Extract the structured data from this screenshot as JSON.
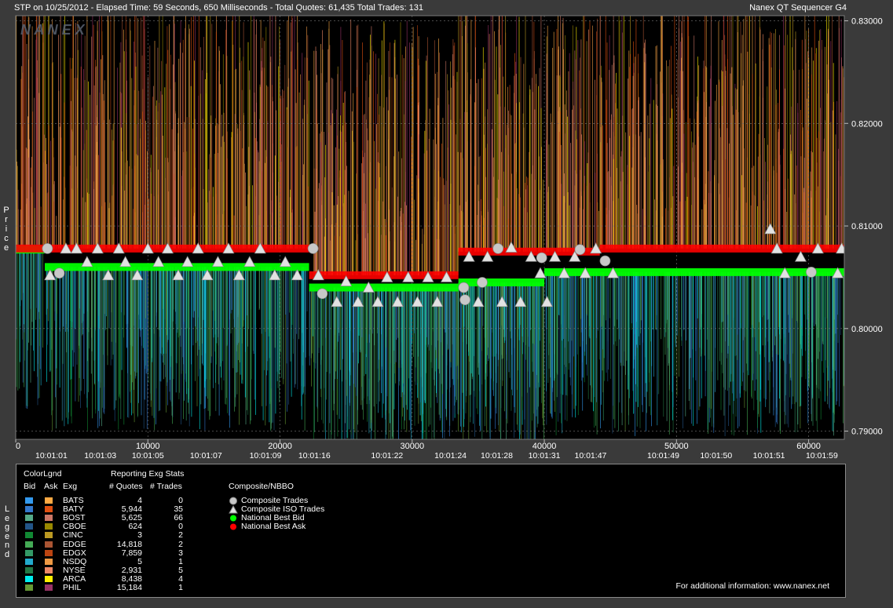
{
  "header": {
    "left": "STP on 10/25/2012  -  Elapsed Time: 59 Seconds, 650 Milliseconds  -  Total Quotes: 61,435  Total Trades: 131",
    "right": "Nanex QT Sequencer G4"
  },
  "watermark": "N A N E X",
  "y_axis_label": [
    "P",
    "r",
    "i",
    "c",
    "e"
  ],
  "legend_vertical": [
    "L",
    "e",
    "g",
    "e",
    "n",
    "d"
  ],
  "colors": {
    "background": "#000000",
    "frame": "#3a3a3a",
    "national_best_bid": "#00ff00",
    "national_best_ask": "#ff0000",
    "trade_marker": "#c8c8c8"
  },
  "chart_data": {
    "type": "scatter",
    "title": "",
    "xlabel": "",
    "ylabel": "Price",
    "xlim": [
      0,
      62700
    ],
    "ylim": [
      0.7892,
      0.8305
    ],
    "y_ticks": [
      "0.83000",
      "0.82000",
      "0.81000",
      "0.80000",
      "0.79000"
    ],
    "x_ticks": [
      {
        "v": 0,
        "label": "0"
      },
      {
        "v": 10000,
        "label": "10000"
      },
      {
        "v": 20000,
        "label": "20000"
      },
      {
        "v": 30000,
        "label": "30000"
      },
      {
        "v": 40000,
        "label": "40000"
      },
      {
        "v": 50000,
        "label": "50000"
      },
      {
        "v": 60000,
        "label": "60000"
      }
    ],
    "time_labels": [
      {
        "v": 2700,
        "label": "10:01:01"
      },
      {
        "v": 6400,
        "label": "10:01:03"
      },
      {
        "v": 10000,
        "label": "10:01:05"
      },
      {
        "v": 14400,
        "label": "10:01:07"
      },
      {
        "v": 18900,
        "label": "10:01:09"
      },
      {
        "v": 22600,
        "label": "10:01:16"
      },
      {
        "v": 28100,
        "label": "10:01:22"
      },
      {
        "v": 32900,
        "label": "10:01:24"
      },
      {
        "v": 36400,
        "label": "10:01:28"
      },
      {
        "v": 40000,
        "label": "10:01:31"
      },
      {
        "v": 43500,
        "label": "10:01:47"
      },
      {
        "v": 49000,
        "label": "10:01:49"
      },
      {
        "v": 53000,
        "label": "10:01:50"
      },
      {
        "v": 57000,
        "label": "10:01:51"
      },
      {
        "v": 61000,
        "label": "10:01:59"
      }
    ],
    "best_bid": [
      {
        "x0": 0,
        "x1": 2200,
        "y": 0.8077
      },
      {
        "x0": 2200,
        "x1": 22200,
        "y": 0.806
      },
      {
        "x0": 22200,
        "x1": 33500,
        "y": 0.804
      },
      {
        "x0": 33500,
        "x1": 40000,
        "y": 0.8045
      },
      {
        "x0": 40000,
        "x1": 62700,
        "y": 0.8055
      }
    ],
    "best_ask": [
      {
        "x0": 0,
        "x1": 22200,
        "y": 0.8078
      },
      {
        "x0": 22200,
        "x1": 33500,
        "y": 0.8052
      },
      {
        "x0": 33500,
        "x1": 44200,
        "y": 0.8075
      },
      {
        "x0": 44200,
        "x1": 62700,
        "y": 0.8078
      }
    ],
    "composite_trades": [
      {
        "x": 2400,
        "y": 0.8078
      },
      {
        "x": 3300,
        "y": 0.8054
      },
      {
        "x": 22500,
        "y": 0.8078
      },
      {
        "x": 23200,
        "y": 0.8034
      },
      {
        "x": 33900,
        "y": 0.804
      },
      {
        "x": 34000,
        "y": 0.8028
      },
      {
        "x": 35300,
        "y": 0.8045
      },
      {
        "x": 36500,
        "y": 0.8078
      },
      {
        "x": 39800,
        "y": 0.8069
      },
      {
        "x": 42700,
        "y": 0.8077
      },
      {
        "x": 44600,
        "y": 0.8066
      },
      {
        "x": 60200,
        "y": 0.8055
      }
    ],
    "iso_trades": [
      {
        "x": 2600,
        "y": 0.8052
      },
      {
        "x": 3800,
        "y": 0.8078
      },
      {
        "x": 4600,
        "y": 0.8078
      },
      {
        "x": 5400,
        "y": 0.8065
      },
      {
        "x": 6200,
        "y": 0.8078
      },
      {
        "x": 7000,
        "y": 0.8052
      },
      {
        "x": 7800,
        "y": 0.8078
      },
      {
        "x": 8300,
        "y": 0.8065
      },
      {
        "x": 9200,
        "y": 0.8052
      },
      {
        "x": 10000,
        "y": 0.8078
      },
      {
        "x": 10800,
        "y": 0.8065
      },
      {
        "x": 11500,
        "y": 0.8078
      },
      {
        "x": 12300,
        "y": 0.8052
      },
      {
        "x": 13000,
        "y": 0.8065
      },
      {
        "x": 13800,
        "y": 0.8078
      },
      {
        "x": 14500,
        "y": 0.8052
      },
      {
        "x": 15300,
        "y": 0.8065
      },
      {
        "x": 16100,
        "y": 0.8078
      },
      {
        "x": 16900,
        "y": 0.8052
      },
      {
        "x": 17700,
        "y": 0.8065
      },
      {
        "x": 18500,
        "y": 0.8078
      },
      {
        "x": 19600,
        "y": 0.8052
      },
      {
        "x": 20400,
        "y": 0.8065
      },
      {
        "x": 21300,
        "y": 0.8052
      },
      {
        "x": 22900,
        "y": 0.8052
      },
      {
        "x": 24300,
        "y": 0.8026
      },
      {
        "x": 25000,
        "y": 0.8046
      },
      {
        "x": 25900,
        "y": 0.8026
      },
      {
        "x": 26700,
        "y": 0.804
      },
      {
        "x": 27400,
        "y": 0.8026
      },
      {
        "x": 28100,
        "y": 0.805
      },
      {
        "x": 28900,
        "y": 0.8026
      },
      {
        "x": 29700,
        "y": 0.805
      },
      {
        "x": 30400,
        "y": 0.8026
      },
      {
        "x": 31200,
        "y": 0.805
      },
      {
        "x": 31900,
        "y": 0.8026
      },
      {
        "x": 32600,
        "y": 0.805
      },
      {
        "x": 34300,
        "y": 0.807
      },
      {
        "x": 35000,
        "y": 0.8026
      },
      {
        "x": 35700,
        "y": 0.807
      },
      {
        "x": 36800,
        "y": 0.8026
      },
      {
        "x": 37500,
        "y": 0.8079
      },
      {
        "x": 38200,
        "y": 0.8026
      },
      {
        "x": 39000,
        "y": 0.807
      },
      {
        "x": 39700,
        "y": 0.8054
      },
      {
        "x": 40200,
        "y": 0.8026
      },
      {
        "x": 40800,
        "y": 0.807
      },
      {
        "x": 41500,
        "y": 0.8054
      },
      {
        "x": 42300,
        "y": 0.807
      },
      {
        "x": 43100,
        "y": 0.8054
      },
      {
        "x": 43900,
        "y": 0.8078
      },
      {
        "x": 45200,
        "y": 0.8054
      },
      {
        "x": 57100,
        "y": 0.8097
      },
      {
        "x": 57600,
        "y": 0.8078
      },
      {
        "x": 58200,
        "y": 0.8054
      },
      {
        "x": 59400,
        "y": 0.807
      },
      {
        "x": 60700,
        "y": 0.8078
      },
      {
        "x": 62200,
        "y": 0.8054
      },
      {
        "x": 62500,
        "y": 0.8078
      }
    ]
  },
  "legend": {
    "color_legend_title": "ColorLgnd",
    "bid_header": "Bid",
    "ask_header": "Ask",
    "exg_header": "Exg",
    "stats_title": "Reporting Exg Stats",
    "quotes_header": "# Quotes",
    "trades_header": "# Trades",
    "composite_title": "Composite/NBBO",
    "rows": [
      {
        "exg": "BATS",
        "quotes": "4",
        "trades": "0",
        "bid_color": "#3399ee",
        "ask_color": "#ffaa44"
      },
      {
        "exg": "BATY",
        "quotes": "5,944",
        "trades": "35",
        "bid_color": "#3377cc",
        "ask_color": "#e05010"
      },
      {
        "exg": "BOST",
        "quotes": "5,625",
        "trades": "66",
        "bid_color": "#55aa88",
        "ask_color": "#cc7766"
      },
      {
        "exg": "CBOE",
        "quotes": "624",
        "trades": "0",
        "bid_color": "#225588",
        "ask_color": "#998800"
      },
      {
        "exg": "CINC",
        "quotes": "3",
        "trades": "2",
        "bid_color": "#118833",
        "ask_color": "#bb9922"
      },
      {
        "exg": "EDGE",
        "quotes": "14,818",
        "trades": "2",
        "bid_color": "#44aa55",
        "ask_color": "#aa5533"
      },
      {
        "exg": "EDGX",
        "quotes": "7,859",
        "trades": "3",
        "bid_color": "#339966",
        "ask_color": "#bb4411"
      },
      {
        "exg": "NSDQ",
        "quotes": "5",
        "trades": "1",
        "bid_color": "#22aacc",
        "ask_color": "#ee9944"
      },
      {
        "exg": "NYSE",
        "quotes": "2,931",
        "trades": "5",
        "bid_color": "#227744",
        "ask_color": "#ee8866"
      },
      {
        "exg": "ARCA",
        "quotes": "8,438",
        "trades": "4",
        "bid_color": "#00eeee",
        "ask_color": "#ffee00"
      },
      {
        "exg": "PHIL",
        "quotes": "15,184",
        "trades": "1",
        "bid_color": "#669933",
        "ask_color": "#993366"
      }
    ],
    "composite_items": [
      {
        "icon": "circle",
        "label": "Composite Trades"
      },
      {
        "icon": "triangle",
        "label": "Composite ISO Trades"
      },
      {
        "icon": "green-dot",
        "label": "National Best Bid"
      },
      {
        "icon": "red-dot",
        "label": "National Best Ask"
      }
    ],
    "footer": "For additional information: www.nanex.net"
  }
}
